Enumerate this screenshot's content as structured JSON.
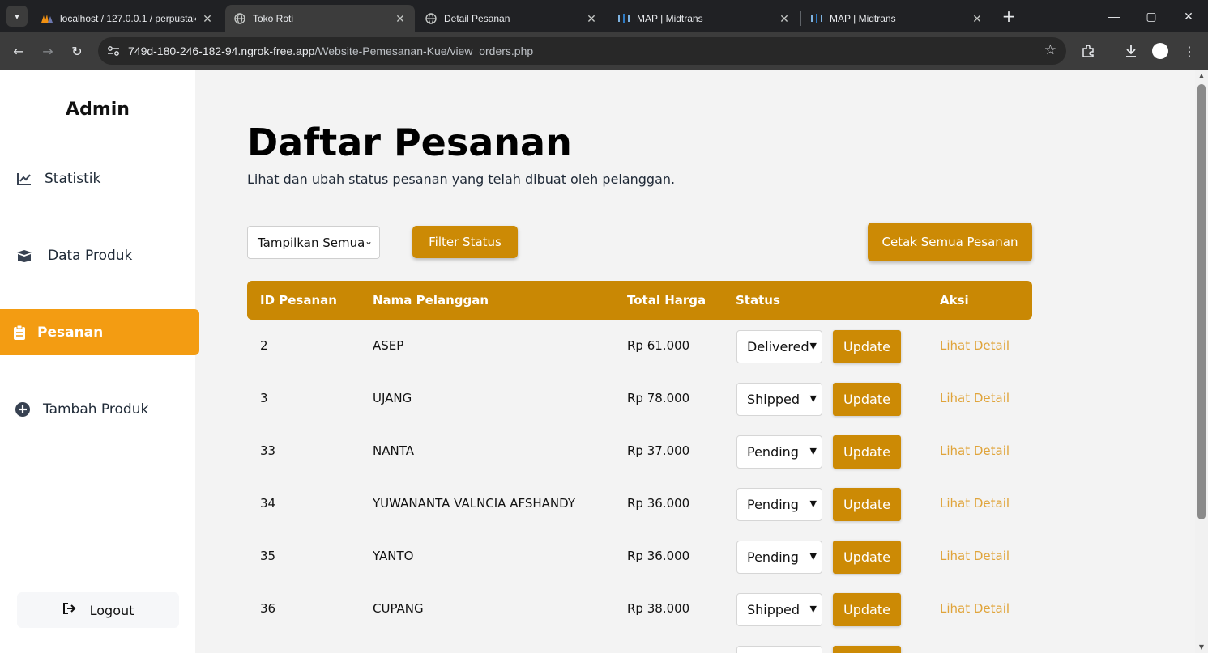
{
  "browser": {
    "tabs": [
      {
        "title": "localhost / 127.0.0.1 / perpustakaan",
        "icon": "phpmyadmin-icon",
        "active": false
      },
      {
        "title": "Toko Roti",
        "icon": "globe-icon",
        "active": true
      },
      {
        "title": "Detail Pesanan",
        "icon": "globe-icon",
        "active": false
      },
      {
        "title": "MAP | Midtrans",
        "icon": "midtrans-icon",
        "active": false
      },
      {
        "title": "MAP | Midtrans",
        "icon": "midtrans-icon",
        "active": false
      }
    ],
    "url_host": "749d-180-246-182-94.ngrok-free.app",
    "url_path": "/Website-Pemesanan-Kue/view_orders.php"
  },
  "sidebar": {
    "title": "Admin",
    "items": [
      {
        "label": "Statistik",
        "icon": "chart-line-icon"
      },
      {
        "label": "Data Produk",
        "icon": "box-open-icon"
      },
      {
        "label": "Pesanan",
        "icon": "clipboard-icon",
        "active": true
      },
      {
        "label": "Tambah Produk",
        "icon": "plus-circle-icon"
      }
    ],
    "logout_label": "Logout"
  },
  "main": {
    "title": "Daftar Pesanan",
    "subtitle": "Lihat dan ubah status pesanan yang telah dibuat oleh pelanggan.",
    "filter_value": "Tampilkan Semua",
    "filter_button": "Filter Status",
    "print_button": "Cetak Semua Pesanan",
    "columns": [
      "ID Pesanan",
      "Nama Pelanggan",
      "Total Harga",
      "Status",
      "Aksi"
    ],
    "orders": [
      {
        "id": "2",
        "name": "ASEP",
        "total": "Rp 61.000",
        "status": "Delivered",
        "update": "Update",
        "detail": "Lihat Detail"
      },
      {
        "id": "3",
        "name": "UJANG",
        "total": "Rp 78.000",
        "status": "Shipped",
        "update": "Update",
        "detail": "Lihat Detail"
      },
      {
        "id": "33",
        "name": "NANTA",
        "total": "Rp 37.000",
        "status": "Pending",
        "update": "Update",
        "detail": "Lihat Detail"
      },
      {
        "id": "34",
        "name": "YUWANANTA VALNCIA AFSHANDY",
        "total": "Rp 36.000",
        "status": "Pending",
        "update": "Update",
        "detail": "Lihat Detail"
      },
      {
        "id": "35",
        "name": "YANTO",
        "total": "Rp 36.000",
        "status": "Pending",
        "update": "Update",
        "detail": "Lihat Detail"
      },
      {
        "id": "36",
        "name": "CUPANG",
        "total": "Rp 38.000",
        "status": "Shipped",
        "update": "Update",
        "detail": "Lihat Detail"
      }
    ]
  },
  "colors": {
    "accent": "#cc8a05",
    "sidebar_active": "#f39c12",
    "link": "#e0a43a"
  }
}
